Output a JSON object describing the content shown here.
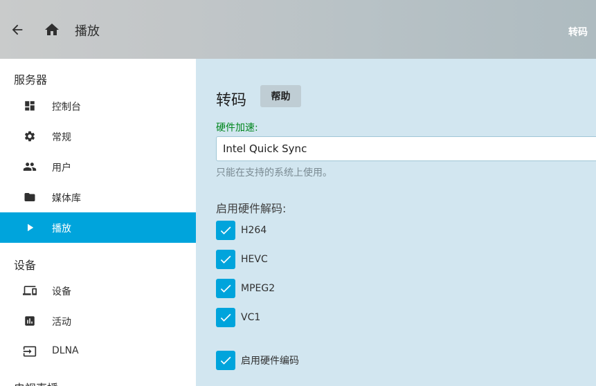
{
  "header": {
    "title": "播放",
    "right_label": "转码",
    "back_icon": "arrow-left-icon",
    "home_icon": "home-icon"
  },
  "sidebar": {
    "sections": [
      {
        "label": "服务器",
        "items": [
          {
            "label": "控制台",
            "icon": "dashboard-icon"
          },
          {
            "label": "常规",
            "icon": "gear-icon"
          },
          {
            "label": "用户",
            "icon": "people-icon"
          },
          {
            "label": "媒体库",
            "icon": "folder-icon"
          },
          {
            "label": "播放",
            "icon": "play-icon",
            "active": true
          }
        ]
      },
      {
        "label": "设备",
        "items": [
          {
            "label": "设备",
            "icon": "devices-icon"
          },
          {
            "label": "活动",
            "icon": "chart-icon"
          },
          {
            "label": "DLNA",
            "icon": "input-icon"
          }
        ]
      },
      {
        "label": "电视直播",
        "items": []
      }
    ]
  },
  "main": {
    "title": "转码",
    "help_label": "帮助",
    "hw_accel_label": "硬件加速:",
    "hw_accel_value": "Intel Quick Sync",
    "hw_accel_desc": "只能在支持的系统上使用。",
    "decoding_label": "启用硬件解码:",
    "decoders": [
      {
        "label": "H264",
        "checked": true
      },
      {
        "label": "HEVC",
        "checked": true
      },
      {
        "label": "MPEG2",
        "checked": true
      },
      {
        "label": "VC1",
        "checked": true
      }
    ],
    "encoding": {
      "label": "启用硬件编码",
      "checked": true
    }
  },
  "colors": {
    "accent": "#00a4dc",
    "field_label": "#00861d",
    "content_bg": "#d2e6f0"
  }
}
